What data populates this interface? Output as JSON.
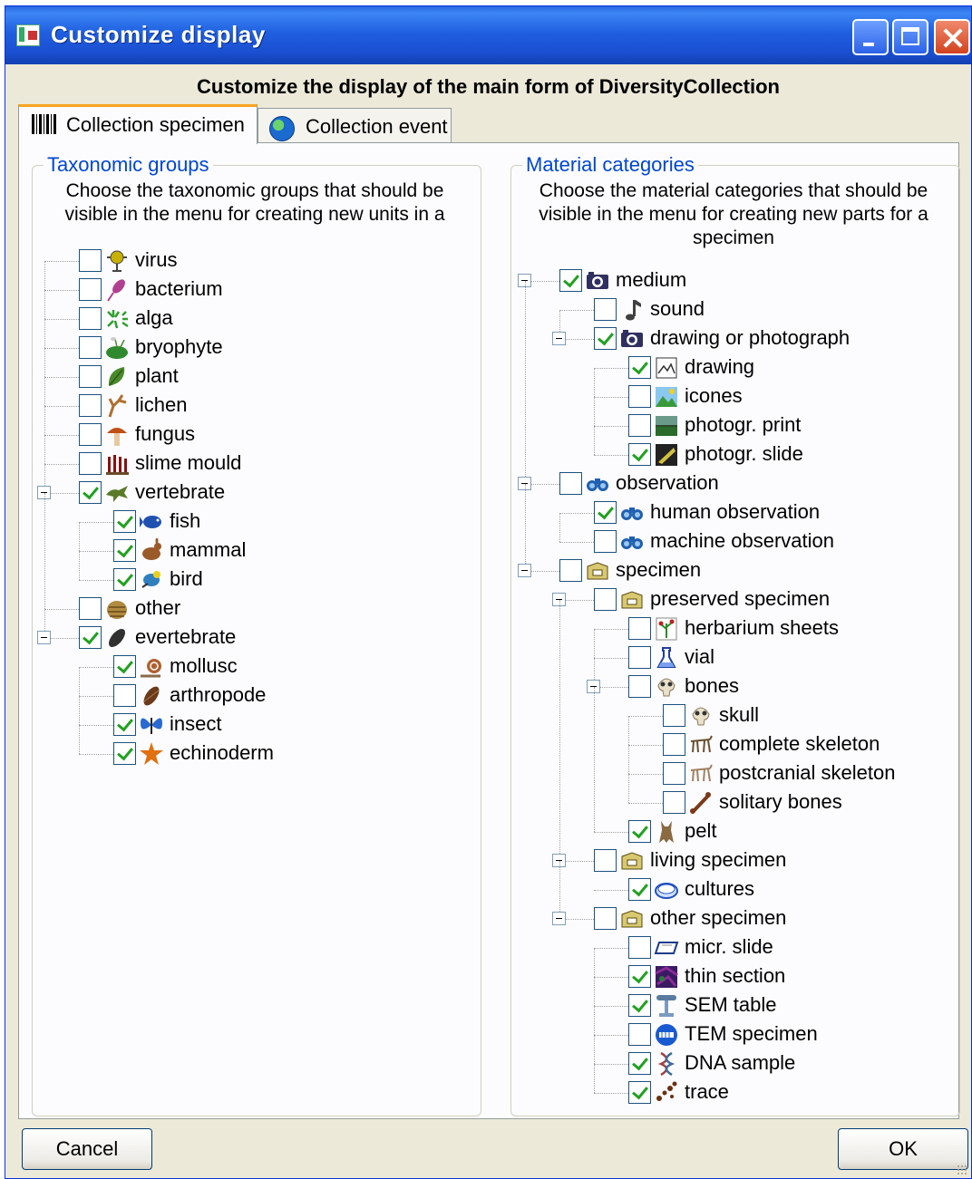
{
  "window": {
    "title": "Customize display"
  },
  "heading": "Customize the display of the main form of DiversityCollection",
  "tabs": [
    {
      "label": "Collection specimen",
      "icon": "barcode-icon",
      "active": true
    },
    {
      "label": "Collection event",
      "icon": "globe-icon",
      "active": false
    }
  ],
  "taxonomic": {
    "legend": "Taxonomic groups",
    "description_line1": "Choose the taxonomic groups that should be",
    "description_line2": "visible in the menu for creating new units in a",
    "items": [
      {
        "label": "virus",
        "checked": false,
        "level": 0,
        "icon": "virus-icon",
        "color": "#c8b000"
      },
      {
        "label": "bacterium",
        "checked": false,
        "level": 0,
        "icon": "bacterium-icon",
        "color": "#b04090"
      },
      {
        "label": "alga",
        "checked": false,
        "level": 0,
        "icon": "alga-icon",
        "color": "#2fa02f"
      },
      {
        "label": "bryophyte",
        "checked": false,
        "level": 0,
        "icon": "bryophyte-icon",
        "color": "#2f8a2f"
      },
      {
        "label": "plant",
        "checked": false,
        "level": 0,
        "icon": "plant-icon",
        "color": "#4a8a2a"
      },
      {
        "label": "lichen",
        "checked": false,
        "level": 0,
        "icon": "lichen-icon",
        "color": "#b07030"
      },
      {
        "label": "fungus",
        "checked": false,
        "level": 0,
        "icon": "fungus-icon",
        "color": "#c05018"
      },
      {
        "label": "slime mould",
        "checked": false,
        "level": 0,
        "icon": "slime-mould-icon",
        "color": "#8a1010"
      },
      {
        "label": "vertebrate",
        "checked": true,
        "level": 0,
        "expanded": true,
        "icon": "vertebrate-icon",
        "color": "#5a7a2a"
      },
      {
        "label": "fish",
        "checked": true,
        "level": 1,
        "icon": "fish-icon",
        "color": "#2050b0"
      },
      {
        "label": "mammal",
        "checked": true,
        "level": 1,
        "icon": "mammal-icon",
        "color": "#9a5a2a"
      },
      {
        "label": "bird",
        "checked": true,
        "level": 1,
        "icon": "bird-icon",
        "color": "#3080c0"
      },
      {
        "label": "other",
        "checked": false,
        "level": 0,
        "icon": "other-icon",
        "color": "#b08a40"
      },
      {
        "label": "evertebrate",
        "checked": true,
        "level": 0,
        "expanded": true,
        "icon": "evertebrate-icon",
        "color": "#303030"
      },
      {
        "label": "mollusc",
        "checked": true,
        "level": 1,
        "icon": "mollusc-icon",
        "color": "#b06030"
      },
      {
        "label": "arthropode",
        "checked": false,
        "level": 1,
        "icon": "arthropode-icon",
        "color": "#6a3a1a"
      },
      {
        "label": "insect",
        "checked": true,
        "level": 1,
        "icon": "insect-icon",
        "color": "#2a6ad0"
      },
      {
        "label": "echinoderm",
        "checked": true,
        "level": 1,
        "icon": "echinoderm-icon",
        "color": "#e07010"
      }
    ]
  },
  "material": {
    "legend": "Material categories",
    "description_line1": "Choose the material categories that should be",
    "description_line2": "visible in the menu for creating new parts for a",
    "description_line3": "specimen",
    "items": [
      {
        "label": "medium",
        "checked": true,
        "level": 0,
        "expanded": true,
        "icon": "camera-icon",
        "color": "#303060"
      },
      {
        "label": "sound",
        "checked": false,
        "level": 1,
        "icon": "music-note-icon",
        "color": "#404040"
      },
      {
        "label": "drawing or photograph",
        "checked": true,
        "level": 1,
        "expanded": true,
        "icon": "camera-icon",
        "color": "#303060"
      },
      {
        "label": "drawing",
        "checked": true,
        "level": 2,
        "icon": "drawing-icon",
        "color": "#707070"
      },
      {
        "label": "icones",
        "checked": false,
        "level": 2,
        "icon": "landscape-icon",
        "color": "#3a9a3a"
      },
      {
        "label": "photogr. print",
        "checked": false,
        "level": 2,
        "icon": "photo-print-icon",
        "color": "#2a6a2a"
      },
      {
        "label": "photogr. slide",
        "checked": true,
        "level": 2,
        "icon": "slide-icon",
        "color": "#505020"
      },
      {
        "label": "observation",
        "checked": false,
        "level": 0,
        "expanded": true,
        "icon": "binoculars-icon",
        "color": "#2060b0"
      },
      {
        "label": "human observation",
        "checked": true,
        "level": 1,
        "icon": "binoculars-icon",
        "color": "#2060b0"
      },
      {
        "label": "machine observation",
        "checked": false,
        "level": 1,
        "icon": "binoculars-icon",
        "color": "#2060b0"
      },
      {
        "label": "specimen",
        "checked": false,
        "level": 0,
        "expanded": true,
        "icon": "box-icon",
        "color": "#a09040"
      },
      {
        "label": "preserved specimen",
        "checked": false,
        "level": 1,
        "expanded": true,
        "icon": "box-icon",
        "color": "#a09040"
      },
      {
        "label": "herbarium sheets",
        "checked": false,
        "level": 2,
        "icon": "herbarium-icon",
        "color": "#c02020"
      },
      {
        "label": "vial",
        "checked": false,
        "level": 2,
        "icon": "vial-icon",
        "color": "#2040a0"
      },
      {
        "label": "bones",
        "checked": false,
        "level": 2,
        "expanded": true,
        "icon": "skull-icon",
        "color": "#8a7a60"
      },
      {
        "label": "skull",
        "checked": false,
        "level": 3,
        "icon": "skull-icon",
        "color": "#8a7a60"
      },
      {
        "label": "complete skeleton",
        "checked": false,
        "level": 3,
        "icon": "skeleton-icon",
        "color": "#6a5030"
      },
      {
        "label": "postcranial skeleton",
        "checked": false,
        "level": 3,
        "icon": "skeleton-icon",
        "color": "#a08060"
      },
      {
        "label": "solitary bones",
        "checked": false,
        "level": 3,
        "icon": "bone-icon",
        "color": "#7a3a1a"
      },
      {
        "label": "pelt",
        "checked": true,
        "level": 2,
        "icon": "pelt-icon",
        "color": "#8a6a40"
      },
      {
        "label": "living specimen",
        "checked": false,
        "level": 1,
        "expanded": true,
        "icon": "box-icon",
        "color": "#a09040"
      },
      {
        "label": "cultures",
        "checked": true,
        "level": 2,
        "icon": "petri-dish-icon",
        "color": "#2050c0"
      },
      {
        "label": "other specimen",
        "checked": false,
        "level": 1,
        "expanded": true,
        "icon": "box-icon",
        "color": "#a09040"
      },
      {
        "label": "micr. slide",
        "checked": false,
        "level": 2,
        "icon": "micr-slide-icon",
        "color": "#1a3a8a"
      },
      {
        "label": "thin section",
        "checked": true,
        "level": 2,
        "icon": "thin-section-icon",
        "color": "#8a2a9a"
      },
      {
        "label": "SEM table",
        "checked": true,
        "level": 2,
        "icon": "sem-table-icon",
        "color": "#5a7aa0"
      },
      {
        "label": "TEM specimen",
        "checked": false,
        "level": 2,
        "icon": "tem-specimen-icon",
        "color": "#1a5ad0"
      },
      {
        "label": "DNA sample",
        "checked": true,
        "level": 2,
        "icon": "dna-icon",
        "color": "#a04040"
      },
      {
        "label": "trace",
        "checked": true,
        "level": 2,
        "icon": "trace-icon",
        "color": "#6a3010"
      }
    ]
  },
  "buttons": {
    "cancel": "Cancel",
    "ok": "OK"
  }
}
